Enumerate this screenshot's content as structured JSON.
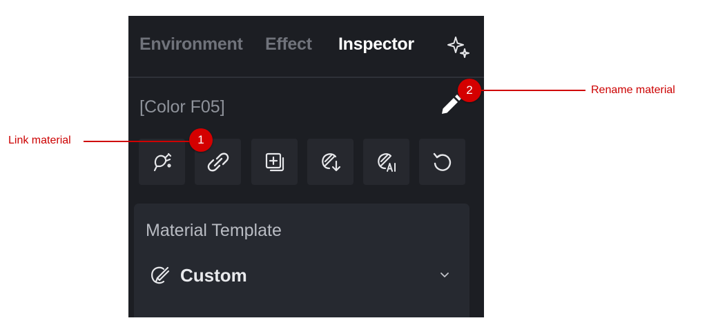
{
  "tabs": [
    {
      "label": "Environment",
      "active": false
    },
    {
      "label": "Effect",
      "active": false
    },
    {
      "label": "Inspector",
      "active": true
    }
  ],
  "material": {
    "name": "[Color F05]"
  },
  "toolbar": {
    "buttons": [
      {
        "icon": "dropper-icon"
      },
      {
        "icon": "link-icon"
      },
      {
        "icon": "duplicate-icon"
      },
      {
        "icon": "download-material-icon"
      },
      {
        "icon": "ai-material-icon"
      },
      {
        "icon": "reset-icon"
      }
    ]
  },
  "template": {
    "title": "Material Template",
    "value": "Custom",
    "value_icon": "material-icon",
    "dropdown_icon": "chevron-down-icon"
  },
  "annotations": [
    {
      "number": "1",
      "label": "Link material"
    },
    {
      "number": "2",
      "label": "Rename material"
    }
  ],
  "colors": {
    "panel_bg": "#1c1e23",
    "button_bg": "#26282e",
    "card_bg": "#262930",
    "annotation_red": "#d00000",
    "active_tab": "#ffffff",
    "inactive_tab": "#70737b"
  }
}
